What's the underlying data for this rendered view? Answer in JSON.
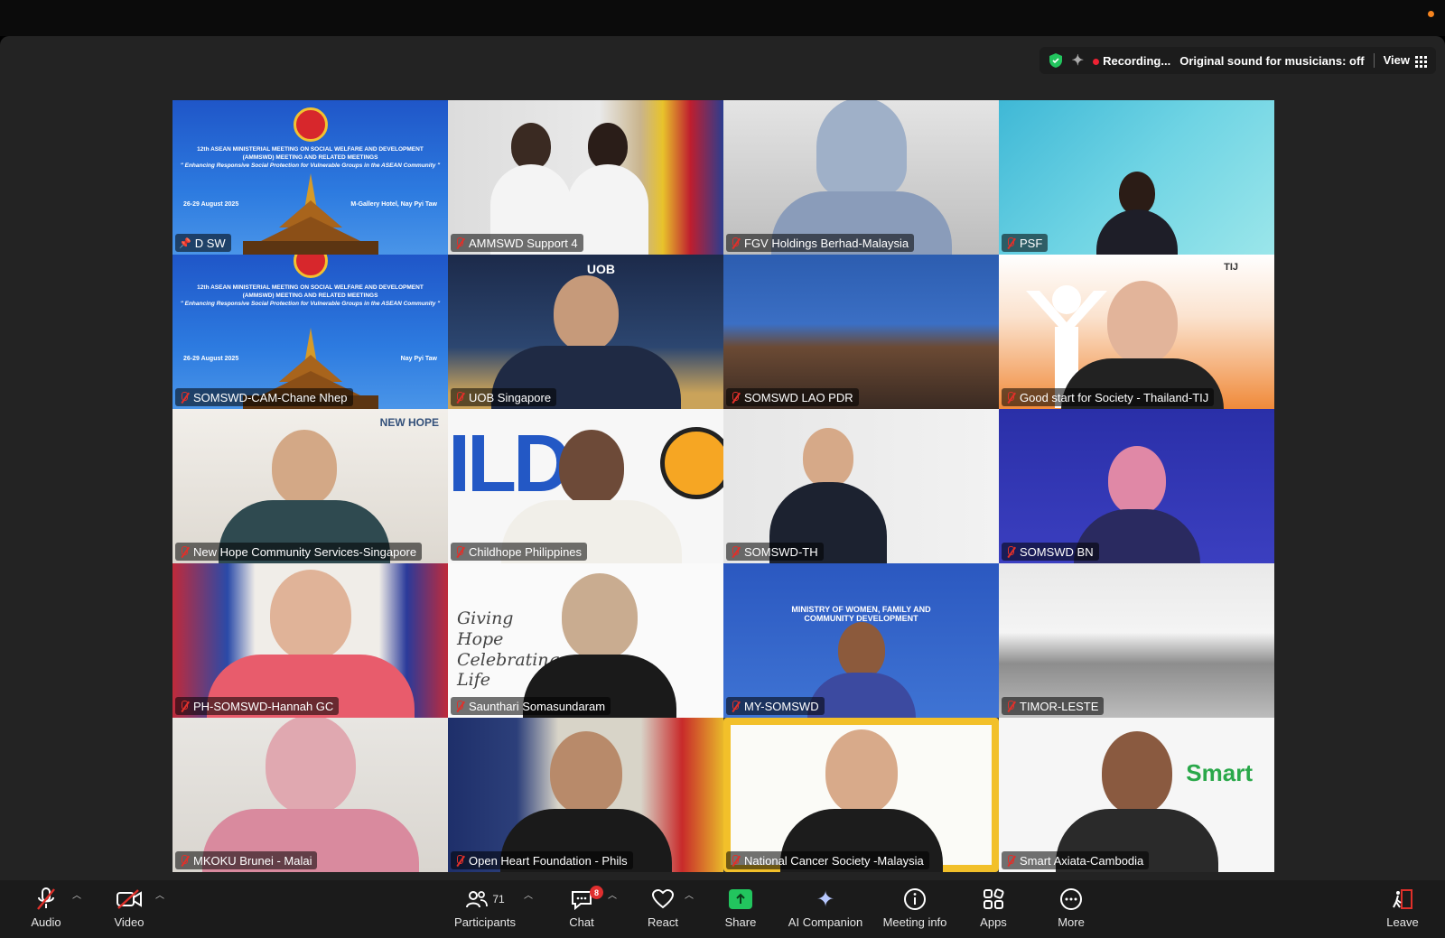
{
  "status": {
    "recording": "Recording...",
    "original_sound": "Original sound for musicians: off",
    "view": "View"
  },
  "banner": {
    "title_line1": "12th ASEAN MINISTERIAL MEETING ON SOCIAL WELFARE AND DEVELOPMENT",
    "title_line2": "(AMMSWD) MEETING AND RELATED MEETINGS",
    "title_line3": "\" Enhancing Responsive Social Protection for Vulnerable Groups in the ASEAN Community \"",
    "date": "26-29 August 2025",
    "venue": "M-Gallery Hotel, Nay Pyi Taw",
    "venue_short": "Nay Pyi Taw"
  },
  "tiles": [
    {
      "name": "D SW",
      "pinned": true,
      "active": true
    },
    {
      "name": "AMMSWD Support 4"
    },
    {
      "name": "FGV Holdings Berhad-Malaysia"
    },
    {
      "name": "PSF"
    },
    {
      "name": "SOMSWD-CAM-Chane Nhep"
    },
    {
      "name": "UOB Singapore",
      "logo": "UOB"
    },
    {
      "name": "SOMSWD LAO PDR"
    },
    {
      "name": "Good start for Society - Thailand-TIJ",
      "logo": "TIJ"
    },
    {
      "name": "New Hope Community Services-Singapore",
      "logo": "NEW HOPE"
    },
    {
      "name": "Childhope Philippines",
      "logo": "ILD"
    },
    {
      "name": "SOMSWD-TH"
    },
    {
      "name": "SOMSWD BN"
    },
    {
      "name": "PH-SOMSWD-Hannah GC"
    },
    {
      "name": "Saunthari Somasundaram",
      "logo": "Giving Hope Celebrating Life"
    },
    {
      "name": "MY-SOMSWD",
      "logo": "MINISTRY OF WOMEN, FAMILY AND COMMUNITY DEVELOPMENT"
    },
    {
      "name": "TIMOR-LESTE"
    },
    {
      "name": "MKOKU Brunei - Malai"
    },
    {
      "name": "Open Heart Foundation - Phils"
    },
    {
      "name": "National Cancer Society -Malaysia"
    },
    {
      "name": "Smart Axiata-Cambodia",
      "logo": "Smart"
    }
  ],
  "toolbar": {
    "audio": "Audio",
    "video": "Video",
    "participants": "Participants",
    "participants_count": "71",
    "chat": "Chat",
    "chat_badge": "8",
    "react": "React",
    "share": "Share",
    "ai_companion": "AI Companion",
    "meeting_info": "Meeting info",
    "apps": "Apps",
    "more": "More",
    "leave": "Leave"
  },
  "colors": {
    "active_speaker": "#2ecc40",
    "muted_mic": "#e0302a",
    "share_green": "#22c55e",
    "recording_dot": "#e23"
  }
}
